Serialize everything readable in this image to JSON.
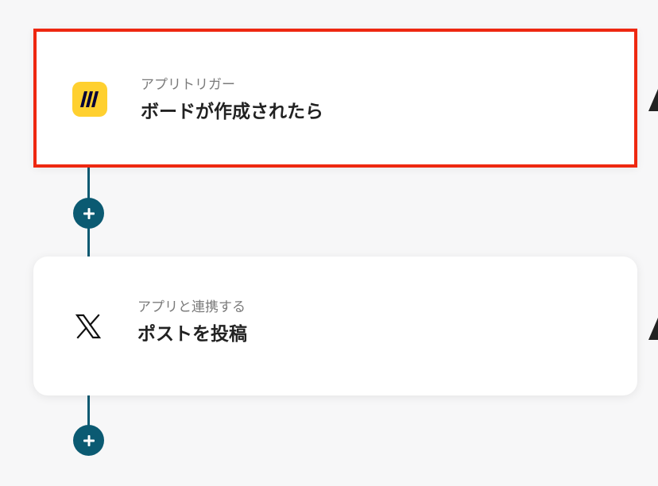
{
  "flow": {
    "steps": [
      {
        "subtitle": "アプリトリガー",
        "title": "ボードが作成されたら",
        "icon": "miro-logo-icon",
        "selected": true,
        "accent_color": "#ee2811",
        "icon_color": "#ffd02f"
      },
      {
        "subtitle": "アプリと連携する",
        "title": "ポストを投稿",
        "icon": "x-logo-icon",
        "selected": false
      }
    ],
    "add_button_icon": "plus-icon",
    "connector_color": "#0b5a72"
  }
}
